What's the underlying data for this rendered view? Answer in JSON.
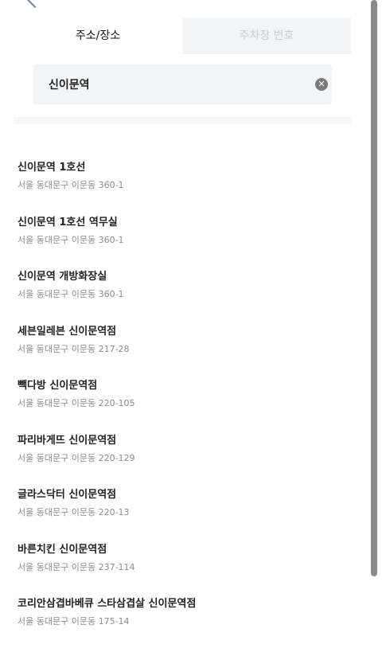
{
  "tabs": [
    {
      "label": "주소/장소",
      "active": true
    },
    {
      "label": "주차장 번호",
      "active": false
    }
  ],
  "search": {
    "value": "신이문역"
  },
  "results": [
    {
      "name": "신이문역 1호선",
      "address": "서울 동대문구 이문동 360-1"
    },
    {
      "name": "신이문역 1호선 역무실",
      "address": "서울 동대문구 이문동 360-1"
    },
    {
      "name": "신이문역 개방화장실",
      "address": "서울 동대문구 이문동 360-1"
    },
    {
      "name": "세븐일레븐 신이문역점",
      "address": "서울 동대문구 이문동 217-28"
    },
    {
      "name": "빽다방 신이문역점",
      "address": "서울 동대문구 이문동 220-105"
    },
    {
      "name": "파리바게뜨 신이문역점",
      "address": "서울 동대문구 이문동 220-129"
    },
    {
      "name": "글라스닥터 신이문역점",
      "address": "서울 동대문구 이문동 220-13"
    },
    {
      "name": "바른치킨 신이문역점",
      "address": "서울 동대문구 이문동 237-114"
    },
    {
      "name": "코리안삼겹바베큐 스타삼겹살 신이문역점",
      "address": "서울 동대문구 이문동 175-14"
    }
  ],
  "icons": {
    "back": "chevron-left-icon",
    "clear": "clear-circle-icon"
  },
  "colors": {
    "tab_inactive_bg": "#f2f4f6",
    "input_bg": "#f2f4f6",
    "address_text": "#8c8c8c"
  }
}
